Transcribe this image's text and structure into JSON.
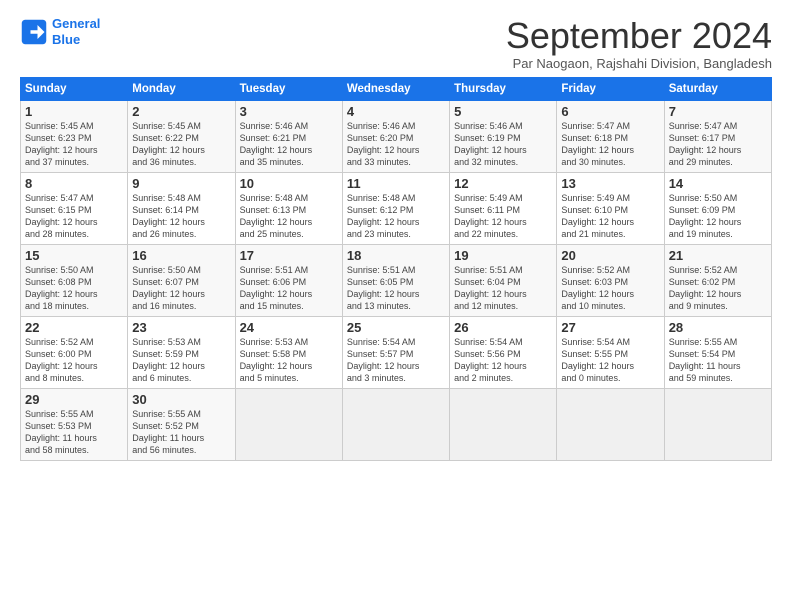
{
  "logo": {
    "line1": "General",
    "line2": "Blue"
  },
  "header": {
    "title": "September 2024",
    "subtitle": "Par Naogaon, Rajshahi Division, Bangladesh"
  },
  "weekdays": [
    "Sunday",
    "Monday",
    "Tuesday",
    "Wednesday",
    "Thursday",
    "Friday",
    "Saturday"
  ],
  "weeks": [
    [
      {
        "day": "1",
        "info": "Sunrise: 5:45 AM\nSunset: 6:23 PM\nDaylight: 12 hours\nand 37 minutes."
      },
      {
        "day": "2",
        "info": "Sunrise: 5:45 AM\nSunset: 6:22 PM\nDaylight: 12 hours\nand 36 minutes."
      },
      {
        "day": "3",
        "info": "Sunrise: 5:46 AM\nSunset: 6:21 PM\nDaylight: 12 hours\nand 35 minutes."
      },
      {
        "day": "4",
        "info": "Sunrise: 5:46 AM\nSunset: 6:20 PM\nDaylight: 12 hours\nand 33 minutes."
      },
      {
        "day": "5",
        "info": "Sunrise: 5:46 AM\nSunset: 6:19 PM\nDaylight: 12 hours\nand 32 minutes."
      },
      {
        "day": "6",
        "info": "Sunrise: 5:47 AM\nSunset: 6:18 PM\nDaylight: 12 hours\nand 30 minutes."
      },
      {
        "day": "7",
        "info": "Sunrise: 5:47 AM\nSunset: 6:17 PM\nDaylight: 12 hours\nand 29 minutes."
      }
    ],
    [
      {
        "day": "8",
        "info": "Sunrise: 5:47 AM\nSunset: 6:15 PM\nDaylight: 12 hours\nand 28 minutes."
      },
      {
        "day": "9",
        "info": "Sunrise: 5:48 AM\nSunset: 6:14 PM\nDaylight: 12 hours\nand 26 minutes."
      },
      {
        "day": "10",
        "info": "Sunrise: 5:48 AM\nSunset: 6:13 PM\nDaylight: 12 hours\nand 25 minutes."
      },
      {
        "day": "11",
        "info": "Sunrise: 5:48 AM\nSunset: 6:12 PM\nDaylight: 12 hours\nand 23 minutes."
      },
      {
        "day": "12",
        "info": "Sunrise: 5:49 AM\nSunset: 6:11 PM\nDaylight: 12 hours\nand 22 minutes."
      },
      {
        "day": "13",
        "info": "Sunrise: 5:49 AM\nSunset: 6:10 PM\nDaylight: 12 hours\nand 21 minutes."
      },
      {
        "day": "14",
        "info": "Sunrise: 5:50 AM\nSunset: 6:09 PM\nDaylight: 12 hours\nand 19 minutes."
      }
    ],
    [
      {
        "day": "15",
        "info": "Sunrise: 5:50 AM\nSunset: 6:08 PM\nDaylight: 12 hours\nand 18 minutes."
      },
      {
        "day": "16",
        "info": "Sunrise: 5:50 AM\nSunset: 6:07 PM\nDaylight: 12 hours\nand 16 minutes."
      },
      {
        "day": "17",
        "info": "Sunrise: 5:51 AM\nSunset: 6:06 PM\nDaylight: 12 hours\nand 15 minutes."
      },
      {
        "day": "18",
        "info": "Sunrise: 5:51 AM\nSunset: 6:05 PM\nDaylight: 12 hours\nand 13 minutes."
      },
      {
        "day": "19",
        "info": "Sunrise: 5:51 AM\nSunset: 6:04 PM\nDaylight: 12 hours\nand 12 minutes."
      },
      {
        "day": "20",
        "info": "Sunrise: 5:52 AM\nSunset: 6:03 PM\nDaylight: 12 hours\nand 10 minutes."
      },
      {
        "day": "21",
        "info": "Sunrise: 5:52 AM\nSunset: 6:02 PM\nDaylight: 12 hours\nand 9 minutes."
      }
    ],
    [
      {
        "day": "22",
        "info": "Sunrise: 5:52 AM\nSunset: 6:00 PM\nDaylight: 12 hours\nand 8 minutes."
      },
      {
        "day": "23",
        "info": "Sunrise: 5:53 AM\nSunset: 5:59 PM\nDaylight: 12 hours\nand 6 minutes."
      },
      {
        "day": "24",
        "info": "Sunrise: 5:53 AM\nSunset: 5:58 PM\nDaylight: 12 hours\nand 5 minutes."
      },
      {
        "day": "25",
        "info": "Sunrise: 5:54 AM\nSunset: 5:57 PM\nDaylight: 12 hours\nand 3 minutes."
      },
      {
        "day": "26",
        "info": "Sunrise: 5:54 AM\nSunset: 5:56 PM\nDaylight: 12 hours\nand 2 minutes."
      },
      {
        "day": "27",
        "info": "Sunrise: 5:54 AM\nSunset: 5:55 PM\nDaylight: 12 hours\nand 0 minutes."
      },
      {
        "day": "28",
        "info": "Sunrise: 5:55 AM\nSunset: 5:54 PM\nDaylight: 11 hours\nand 59 minutes."
      }
    ],
    [
      {
        "day": "29",
        "info": "Sunrise: 5:55 AM\nSunset: 5:53 PM\nDaylight: 11 hours\nand 58 minutes."
      },
      {
        "day": "30",
        "info": "Sunrise: 5:55 AM\nSunset: 5:52 PM\nDaylight: 11 hours\nand 56 minutes."
      },
      {
        "day": "",
        "info": ""
      },
      {
        "day": "",
        "info": ""
      },
      {
        "day": "",
        "info": ""
      },
      {
        "day": "",
        "info": ""
      },
      {
        "day": "",
        "info": ""
      }
    ]
  ]
}
